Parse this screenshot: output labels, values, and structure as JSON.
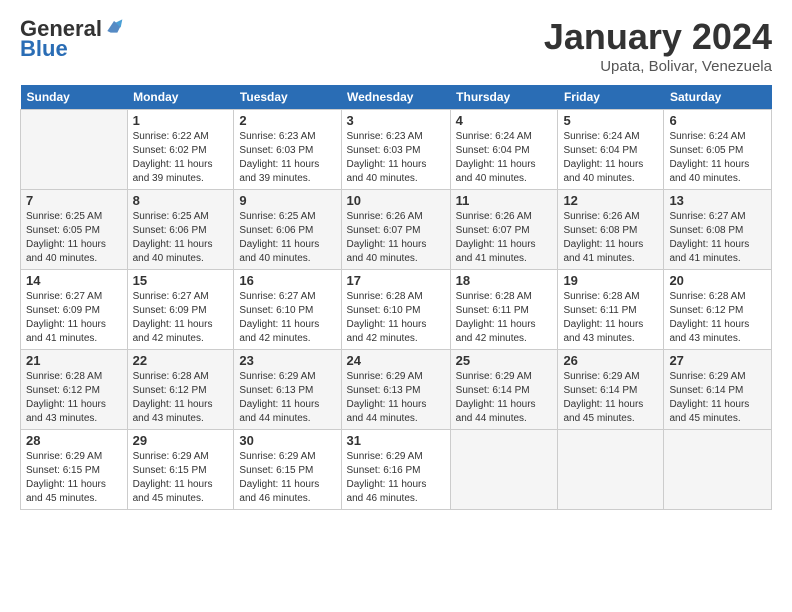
{
  "logo": {
    "general": "General",
    "blue": "Blue"
  },
  "title": "January 2024",
  "subtitle": "Upata, Bolivar, Venezuela",
  "headers": [
    "Sunday",
    "Monday",
    "Tuesday",
    "Wednesday",
    "Thursday",
    "Friday",
    "Saturday"
  ],
  "weeks": [
    [
      {
        "num": "",
        "sunrise": "",
        "sunset": "",
        "daylight": "",
        "empty": true
      },
      {
        "num": "1",
        "sunrise": "Sunrise: 6:22 AM",
        "sunset": "Sunset: 6:02 PM",
        "daylight": "Daylight: 11 hours and 39 minutes."
      },
      {
        "num": "2",
        "sunrise": "Sunrise: 6:23 AM",
        "sunset": "Sunset: 6:03 PM",
        "daylight": "Daylight: 11 hours and 39 minutes."
      },
      {
        "num": "3",
        "sunrise": "Sunrise: 6:23 AM",
        "sunset": "Sunset: 6:03 PM",
        "daylight": "Daylight: 11 hours and 40 minutes."
      },
      {
        "num": "4",
        "sunrise": "Sunrise: 6:24 AM",
        "sunset": "Sunset: 6:04 PM",
        "daylight": "Daylight: 11 hours and 40 minutes."
      },
      {
        "num": "5",
        "sunrise": "Sunrise: 6:24 AM",
        "sunset": "Sunset: 6:04 PM",
        "daylight": "Daylight: 11 hours and 40 minutes."
      },
      {
        "num": "6",
        "sunrise": "Sunrise: 6:24 AM",
        "sunset": "Sunset: 6:05 PM",
        "daylight": "Daylight: 11 hours and 40 minutes."
      }
    ],
    [
      {
        "num": "7",
        "sunrise": "Sunrise: 6:25 AM",
        "sunset": "Sunset: 6:05 PM",
        "daylight": "Daylight: 11 hours and 40 minutes."
      },
      {
        "num": "8",
        "sunrise": "Sunrise: 6:25 AM",
        "sunset": "Sunset: 6:06 PM",
        "daylight": "Daylight: 11 hours and 40 minutes."
      },
      {
        "num": "9",
        "sunrise": "Sunrise: 6:25 AM",
        "sunset": "Sunset: 6:06 PM",
        "daylight": "Daylight: 11 hours and 40 minutes."
      },
      {
        "num": "10",
        "sunrise": "Sunrise: 6:26 AM",
        "sunset": "Sunset: 6:07 PM",
        "daylight": "Daylight: 11 hours and 40 minutes."
      },
      {
        "num": "11",
        "sunrise": "Sunrise: 6:26 AM",
        "sunset": "Sunset: 6:07 PM",
        "daylight": "Daylight: 11 hours and 41 minutes."
      },
      {
        "num": "12",
        "sunrise": "Sunrise: 6:26 AM",
        "sunset": "Sunset: 6:08 PM",
        "daylight": "Daylight: 11 hours and 41 minutes."
      },
      {
        "num": "13",
        "sunrise": "Sunrise: 6:27 AM",
        "sunset": "Sunset: 6:08 PM",
        "daylight": "Daylight: 11 hours and 41 minutes."
      }
    ],
    [
      {
        "num": "14",
        "sunrise": "Sunrise: 6:27 AM",
        "sunset": "Sunset: 6:09 PM",
        "daylight": "Daylight: 11 hours and 41 minutes."
      },
      {
        "num": "15",
        "sunrise": "Sunrise: 6:27 AM",
        "sunset": "Sunset: 6:09 PM",
        "daylight": "Daylight: 11 hours and 42 minutes."
      },
      {
        "num": "16",
        "sunrise": "Sunrise: 6:27 AM",
        "sunset": "Sunset: 6:10 PM",
        "daylight": "Daylight: 11 hours and 42 minutes."
      },
      {
        "num": "17",
        "sunrise": "Sunrise: 6:28 AM",
        "sunset": "Sunset: 6:10 PM",
        "daylight": "Daylight: 11 hours and 42 minutes."
      },
      {
        "num": "18",
        "sunrise": "Sunrise: 6:28 AM",
        "sunset": "Sunset: 6:11 PM",
        "daylight": "Daylight: 11 hours and 42 minutes."
      },
      {
        "num": "19",
        "sunrise": "Sunrise: 6:28 AM",
        "sunset": "Sunset: 6:11 PM",
        "daylight": "Daylight: 11 hours and 43 minutes."
      },
      {
        "num": "20",
        "sunrise": "Sunrise: 6:28 AM",
        "sunset": "Sunset: 6:12 PM",
        "daylight": "Daylight: 11 hours and 43 minutes."
      }
    ],
    [
      {
        "num": "21",
        "sunrise": "Sunrise: 6:28 AM",
        "sunset": "Sunset: 6:12 PM",
        "daylight": "Daylight: 11 hours and 43 minutes."
      },
      {
        "num": "22",
        "sunrise": "Sunrise: 6:28 AM",
        "sunset": "Sunset: 6:12 PM",
        "daylight": "Daylight: 11 hours and 43 minutes."
      },
      {
        "num": "23",
        "sunrise": "Sunrise: 6:29 AM",
        "sunset": "Sunset: 6:13 PM",
        "daylight": "Daylight: 11 hours and 44 minutes."
      },
      {
        "num": "24",
        "sunrise": "Sunrise: 6:29 AM",
        "sunset": "Sunset: 6:13 PM",
        "daylight": "Daylight: 11 hours and 44 minutes."
      },
      {
        "num": "25",
        "sunrise": "Sunrise: 6:29 AM",
        "sunset": "Sunset: 6:14 PM",
        "daylight": "Daylight: 11 hours and 44 minutes."
      },
      {
        "num": "26",
        "sunrise": "Sunrise: 6:29 AM",
        "sunset": "Sunset: 6:14 PM",
        "daylight": "Daylight: 11 hours and 45 minutes."
      },
      {
        "num": "27",
        "sunrise": "Sunrise: 6:29 AM",
        "sunset": "Sunset: 6:14 PM",
        "daylight": "Daylight: 11 hours and 45 minutes."
      }
    ],
    [
      {
        "num": "28",
        "sunrise": "Sunrise: 6:29 AM",
        "sunset": "Sunset: 6:15 PM",
        "daylight": "Daylight: 11 hours and 45 minutes."
      },
      {
        "num": "29",
        "sunrise": "Sunrise: 6:29 AM",
        "sunset": "Sunset: 6:15 PM",
        "daylight": "Daylight: 11 hours and 45 minutes."
      },
      {
        "num": "30",
        "sunrise": "Sunrise: 6:29 AM",
        "sunset": "Sunset: 6:15 PM",
        "daylight": "Daylight: 11 hours and 46 minutes."
      },
      {
        "num": "31",
        "sunrise": "Sunrise: 6:29 AM",
        "sunset": "Sunset: 6:16 PM",
        "daylight": "Daylight: 11 hours and 46 minutes."
      },
      {
        "num": "",
        "sunrise": "",
        "sunset": "",
        "daylight": "",
        "empty": true
      },
      {
        "num": "",
        "sunrise": "",
        "sunset": "",
        "daylight": "",
        "empty": true
      },
      {
        "num": "",
        "sunrise": "",
        "sunset": "",
        "daylight": "",
        "empty": true
      }
    ]
  ]
}
